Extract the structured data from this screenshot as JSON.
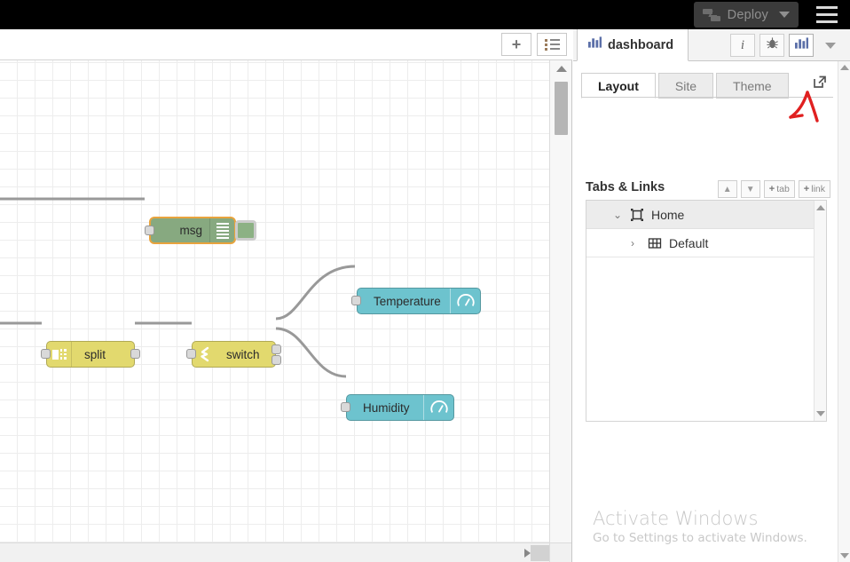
{
  "header": {
    "deploy_label": "Deploy",
    "deploy_icon": "deploy-icon",
    "caret_icon": "chevron-down-icon",
    "menu_icon": "hamburger-menu-icon"
  },
  "workspace": {
    "toolbar": {
      "add_tab_label": "+",
      "add_tab_icon": "plus-icon",
      "list_tabs_icon": "list-icon"
    },
    "nodes": [
      {
        "id": "debug",
        "label": "msg",
        "type": "debug",
        "color": "#87a980",
        "selected_border": "#e8a33d",
        "icon": "debug-lines-icon",
        "button_icon": "debug-toggle-button"
      },
      {
        "id": "split",
        "label": "split",
        "type": "split",
        "color": "#e2d96e",
        "icon": "split-icon"
      },
      {
        "id": "switch",
        "label": "switch",
        "type": "switch",
        "color": "#e2d96e",
        "icon": "switch-arrows-icon"
      },
      {
        "id": "temperature",
        "label": "Temperature",
        "type": "ui_gauge",
        "color": "#6dc3ce",
        "icon": "gauge-icon"
      },
      {
        "id": "humidity",
        "label": "Humidity",
        "type": "ui_gauge",
        "color": "#6dc3ce",
        "icon": "gauge-icon"
      }
    ],
    "scroll": {
      "v_up_icon": "scroll-up-arrow",
      "v_down_icon": "scroll-down-arrow",
      "h_right_icon": "scroll-right-arrow"
    }
  },
  "sidebar": {
    "title": "dashboard",
    "title_icon": "dashboard-chart-icon",
    "header_buttons": [
      {
        "name": "info-tab",
        "icon": "info-icon",
        "label": "i",
        "active": false
      },
      {
        "name": "debug-tab",
        "icon": "bug-icon",
        "label": "",
        "active": false
      },
      {
        "name": "dashboard-tab",
        "icon": "chart-icon",
        "label": "",
        "active": true
      },
      {
        "name": "more-tabs",
        "icon": "chevron-down-icon",
        "label": "",
        "active": false
      }
    ],
    "subtabs": [
      {
        "label": "Layout",
        "active": true
      },
      {
        "label": "Site",
        "active": false
      },
      {
        "label": "Theme",
        "active": false
      }
    ],
    "open_dashboard_icon": "external-link-icon",
    "section": {
      "title": "Tabs & Links",
      "buttons": [
        {
          "name": "collapse-all-button",
          "label": "",
          "icon": "chevron-up-icon"
        },
        {
          "name": "expand-all-button",
          "label": "",
          "icon": "chevron-down-icon"
        },
        {
          "name": "add-tab-button",
          "label": "tab",
          "icon": "plus-icon"
        },
        {
          "name": "add-link-button",
          "label": "link",
          "icon": "plus-icon"
        }
      ]
    },
    "tree": [
      {
        "label": "Home",
        "level": 0,
        "expanded": true,
        "caret": "⌄",
        "icon": "tab-icon"
      },
      {
        "label": "Default",
        "level": 1,
        "expanded": false,
        "caret": "›",
        "icon": "grid-group-icon"
      }
    ],
    "scroll": {
      "up_icon": "scroll-up-arrow",
      "down_icon": "scroll-down-arrow"
    }
  },
  "watermark": {
    "title": "Activate Windows",
    "subtitle": "Go to Settings to activate Windows."
  },
  "annotation": {
    "arrow_name": "red-pointer-arrow",
    "color": "#e02020"
  }
}
